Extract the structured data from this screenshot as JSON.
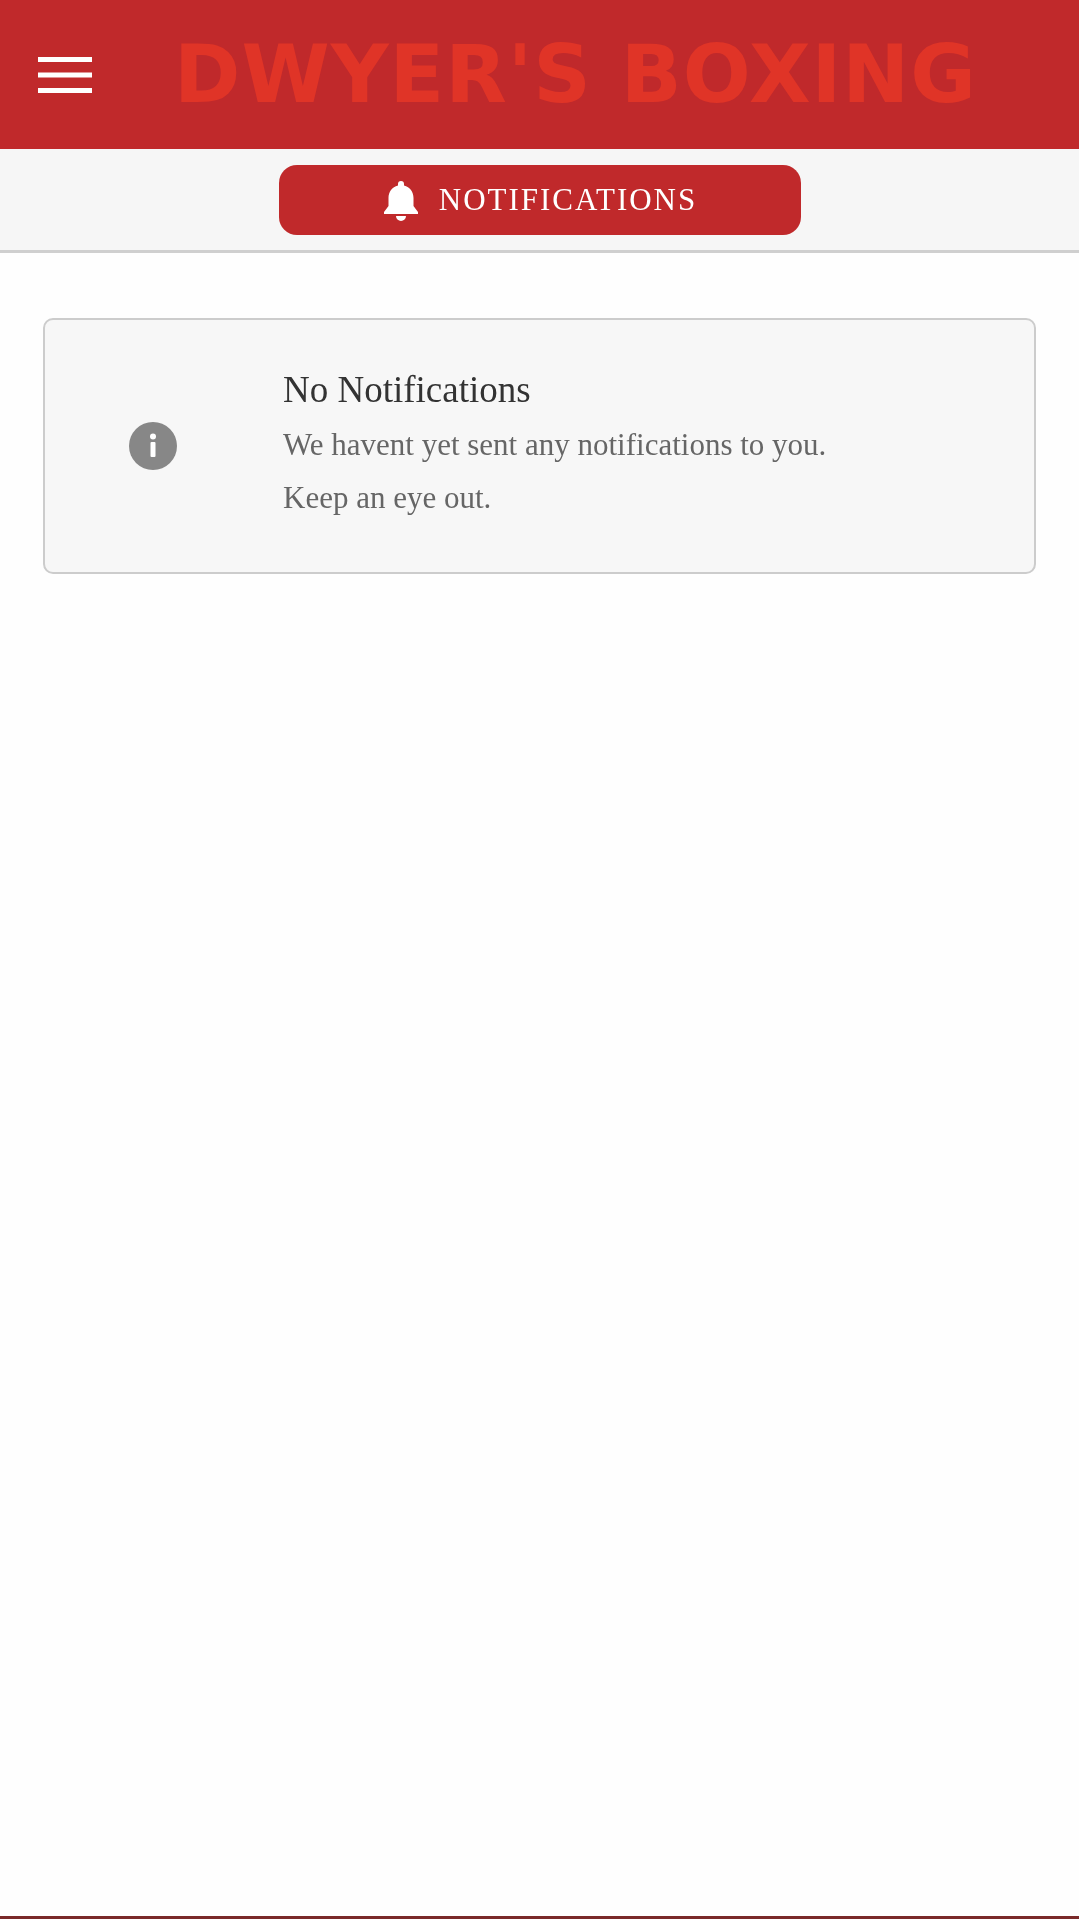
{
  "header": {
    "title": "DWYER'S BOXING"
  },
  "nav": {
    "button": {
      "label": "NOTIFICATIONS"
    }
  },
  "notice": {
    "title": "No Notifications",
    "message_lines": [
      "We havent yet sent any notifications to you.",
      "Keep an eye out."
    ]
  }
}
